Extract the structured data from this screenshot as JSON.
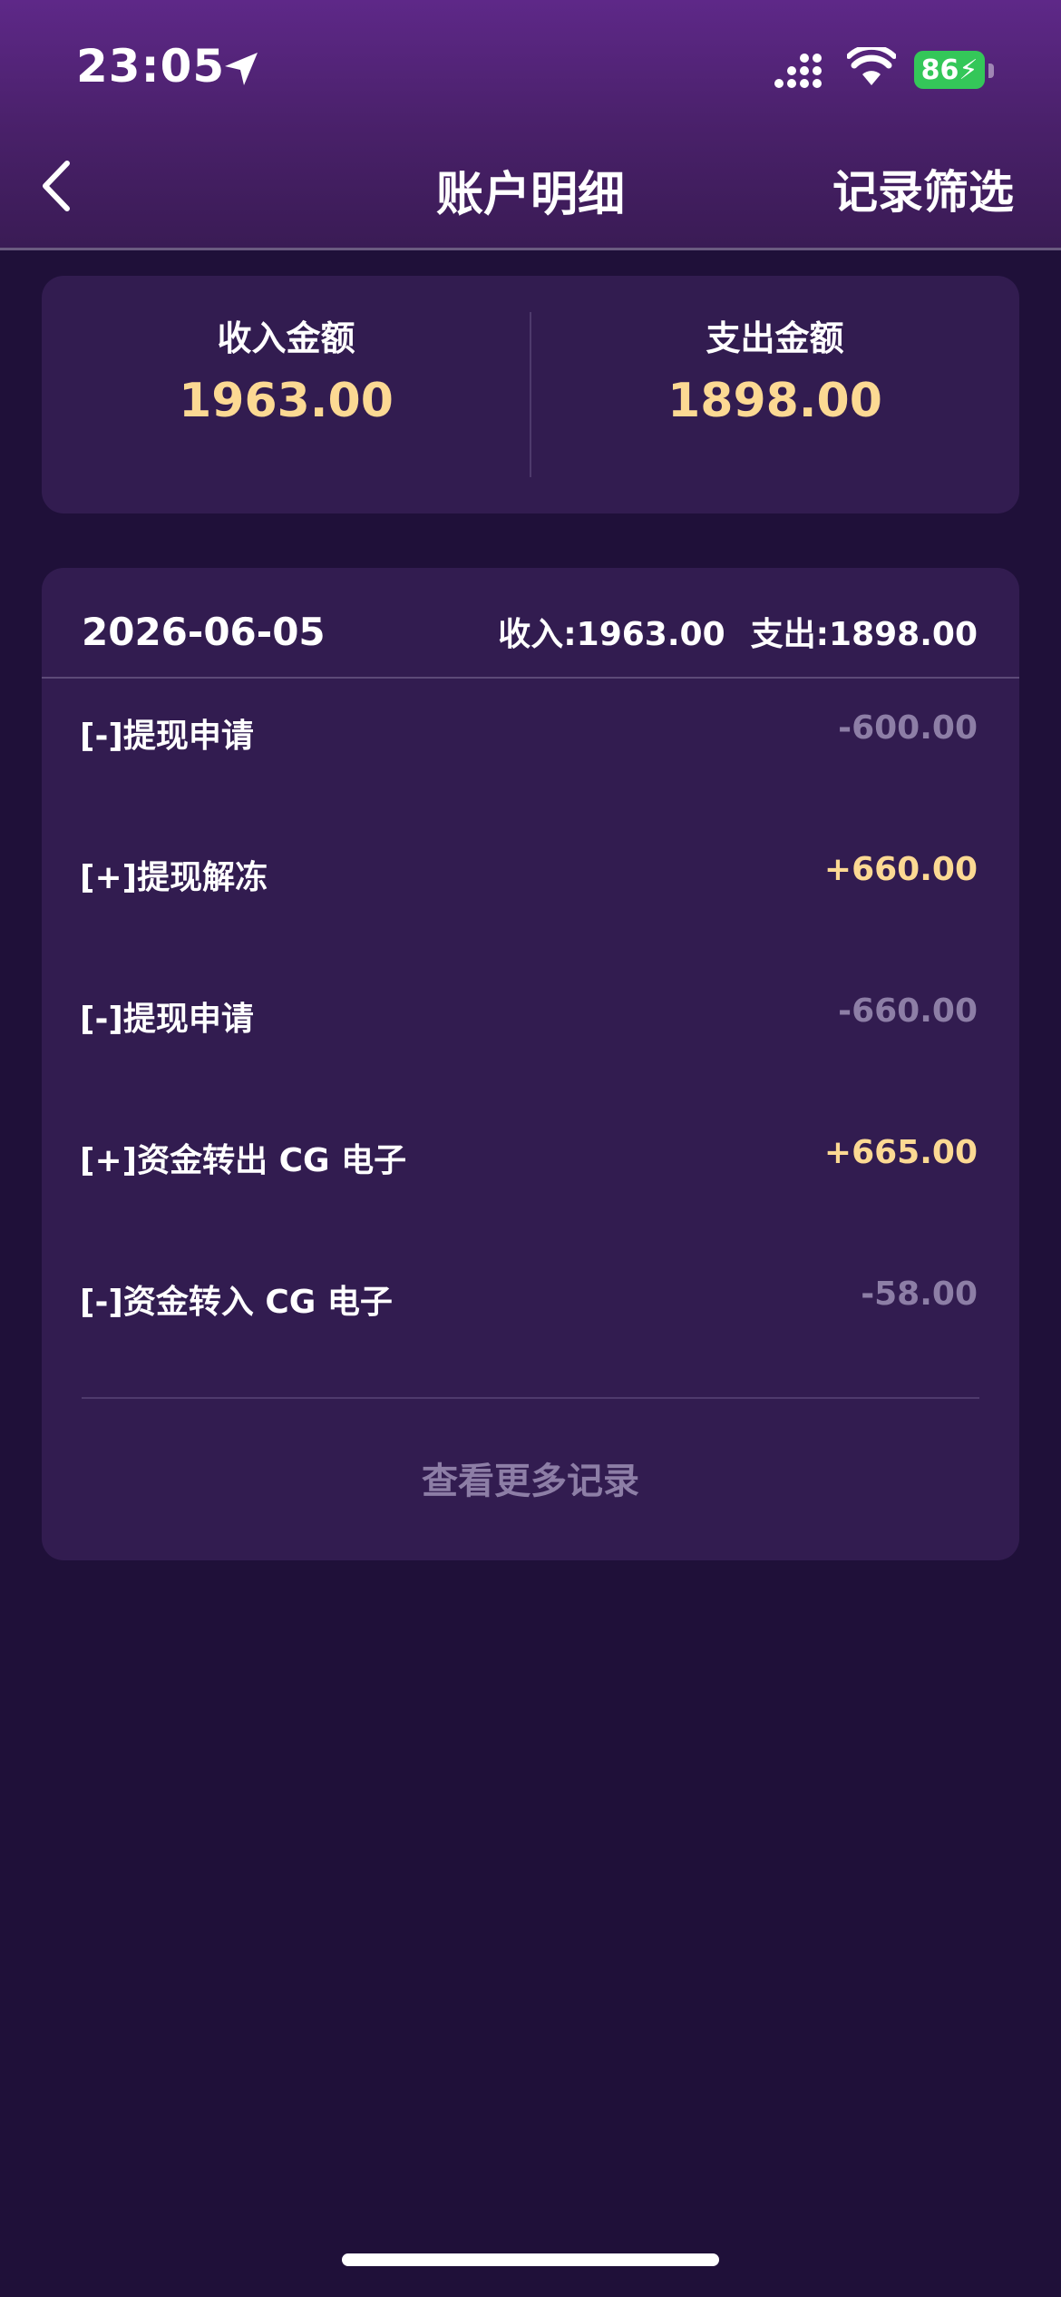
{
  "status_bar": {
    "time": "23:05",
    "battery": "86",
    "icons": [
      "location-arrow-icon",
      "signal-icon",
      "wifi-icon",
      "battery-charging-icon"
    ]
  },
  "nav": {
    "back_icon": "chevron-left-icon",
    "title": "账户明细",
    "filter_label": "记录筛选"
  },
  "summary": {
    "income_label": "收入金额",
    "income_value": "1963.00",
    "expense_label": "支出金额",
    "expense_value": "1898.00"
  },
  "records": {
    "date": "2026-06-05",
    "income_total": "收入:1963.00",
    "expense_total": "支出:1898.00",
    "items": [
      {
        "label": "[-]提现申请",
        "amount": "-600.00",
        "type": "negative"
      },
      {
        "label": "[+]提现解冻",
        "amount": "+660.00",
        "type": "positive"
      },
      {
        "label": "[-]提现申请",
        "amount": "-660.00",
        "type": "negative"
      },
      {
        "label": "[+]资金转出 CG 电子",
        "amount": "+665.00",
        "type": "positive"
      },
      {
        "label": "[-]资金转入 CG 电子",
        "amount": "-58.00",
        "type": "negative"
      }
    ],
    "more_label": "查看更多记录"
  },
  "colors": {
    "background": "#1f1039",
    "card": "#321c50",
    "header_top": "#5e2888",
    "gold": "#fcd993",
    "muted": "#8d7ea6",
    "battery": "#34c759"
  }
}
